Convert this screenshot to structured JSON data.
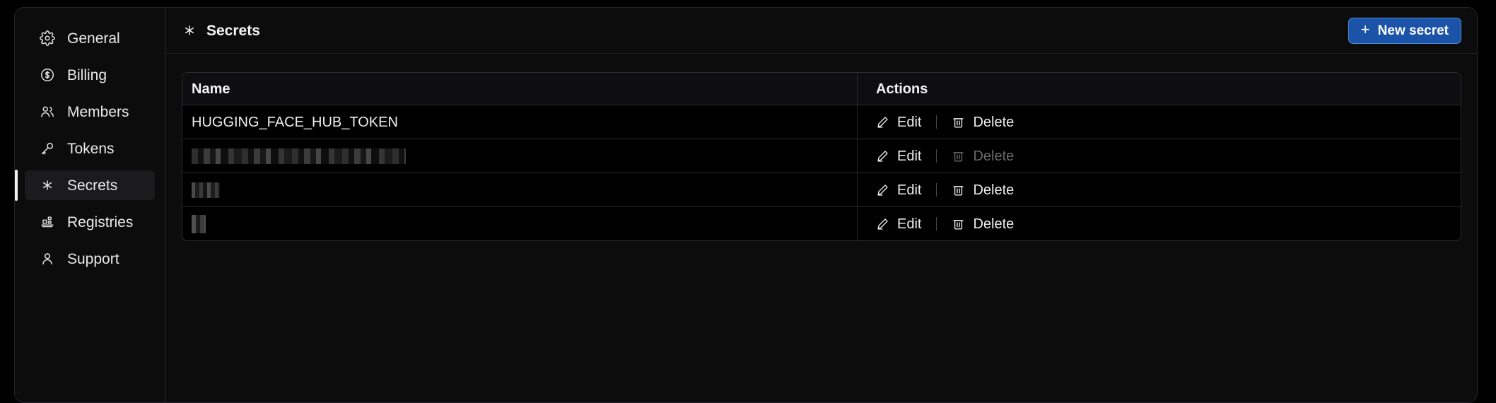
{
  "sidebar": {
    "items": [
      {
        "label": "General",
        "icon": "gear-icon",
        "active": false
      },
      {
        "label": "Billing",
        "icon": "dollar-circle-icon",
        "active": false
      },
      {
        "label": "Members",
        "icon": "users-icon",
        "active": false
      },
      {
        "label": "Tokens",
        "icon": "key-icon",
        "active": false
      },
      {
        "label": "Secrets",
        "icon": "asterisk-icon",
        "active": true
      },
      {
        "label": "Registries",
        "icon": "registries-icon",
        "active": false
      },
      {
        "label": "Support",
        "icon": "person-icon",
        "active": false
      }
    ]
  },
  "header": {
    "title": "Secrets",
    "title_icon": "asterisk-icon",
    "new_secret_label": "New secret",
    "new_secret_plus": "+"
  },
  "table": {
    "columns": [
      "Name",
      "Actions"
    ],
    "rows": [
      {
        "name": "HUGGING_FACE_HUB_TOKEN",
        "redacted": false,
        "redacted_style": "",
        "edit_label": "Edit",
        "delete_label": "Delete",
        "delete_disabled": false
      },
      {
        "name": "",
        "redacted": true,
        "redacted_style": "r1",
        "edit_label": "Edit",
        "delete_label": "Delete",
        "delete_disabled": true
      },
      {
        "name": "",
        "redacted": true,
        "redacted_style": "r2",
        "edit_label": "Edit",
        "delete_label": "Delete",
        "delete_disabled": false
      },
      {
        "name": "",
        "redacted": true,
        "redacted_style": "r3",
        "edit_label": "Edit",
        "delete_label": "Delete",
        "delete_disabled": false
      }
    ]
  },
  "colors": {
    "page_background": "#000000",
    "panel_background": "#0c0c0d",
    "border": "#2c2c31",
    "accent_button": "#1b53a8",
    "accent_button_border": "#4e8cd8",
    "text_primary": "#f4f4f5",
    "text_disabled": "#6a6a6e",
    "active_indicator": "#f2f2f3"
  }
}
